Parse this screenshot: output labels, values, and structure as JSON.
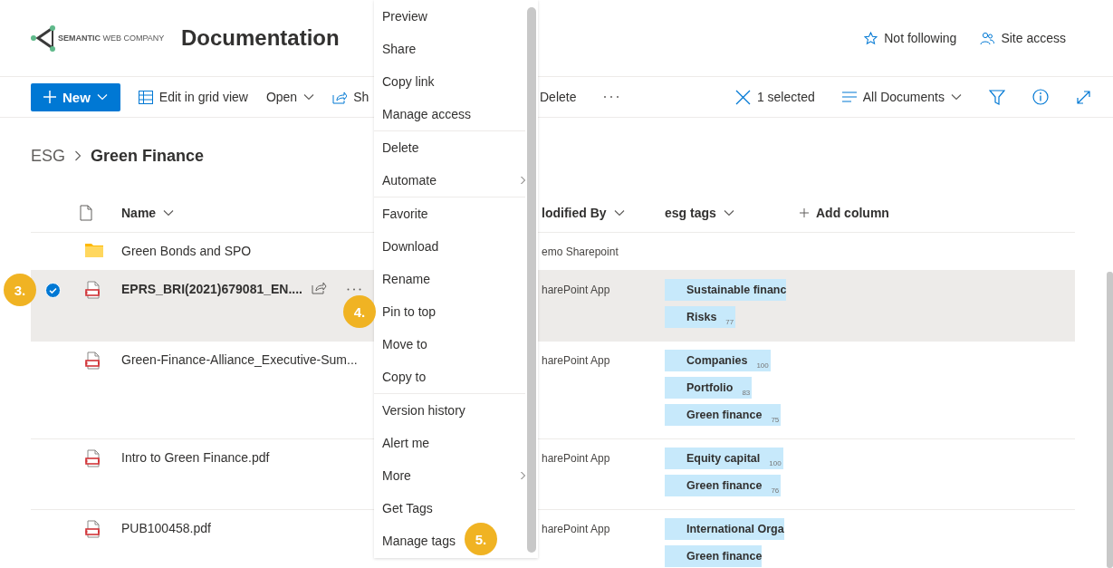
{
  "header": {
    "logo_text": "**SEMANTIC** WEB COMPANY",
    "title": "Documentation",
    "actions": [
      {
        "label": "Not following"
      },
      {
        "label": "Site access"
      }
    ]
  },
  "toolbar": {
    "left": [
      {
        "kind": "primary",
        "label": "New",
        "dropdown": true
      },
      {
        "kind": "grid",
        "label": "Edit in grid view"
      },
      {
        "kind": "plain",
        "label": "Open",
        "dropdown": true
      },
      {
        "kind": "share",
        "label": "Sh"
      }
    ],
    "after": [
      {
        "kind": "plain",
        "label": "Delete"
      },
      {
        "kind": "more"
      }
    ],
    "selection": "1 selected",
    "view": "All Documents"
  },
  "breadcrumb": [
    {
      "label": "ESG",
      "current": false
    },
    {
      "label": "Green Finance",
      "current": true
    }
  ],
  "table": {
    "columns": [
      {
        "label": "Name"
      },
      {
        "label": "lodified By"
      },
      {
        "label": "esg tags"
      }
    ],
    "add_column": "Add column",
    "rows": [
      {
        "kind": "folder",
        "name": "Green Bonds and SPO",
        "selected": false,
        "modified_by": "emo Sharepoint"
      },
      {
        "kind": "pdf",
        "name": "EPRS_BRI(2021)679081_EN....",
        "selected": true,
        "modified_by": "harePoint App",
        "tags": [
          {
            "label": "Sustainable financ"
          },
          {
            "label": "Risks",
            "score": "77"
          }
        ]
      },
      {
        "kind": "pdf",
        "name": "Green-Finance-Alliance_Executive-Sum...",
        "selected": false,
        "modified_by": "harePoint App",
        "tags": [
          {
            "label": "Companies",
            "score": "100"
          },
          {
            "label": "Portfolio",
            "score": "83"
          },
          {
            "label": "Green finance",
            "score": "75"
          }
        ]
      },
      {
        "kind": "pdf",
        "name": "Intro to Green Finance.pdf",
        "selected": false,
        "modified_by": "harePoint App",
        "tags": [
          {
            "label": "Equity capital",
            "score": "100"
          },
          {
            "label": "Green finance",
            "score": "76"
          }
        ]
      },
      {
        "kind": "pdf",
        "name": "PUB100458.pdf",
        "selected": false,
        "modified_by": "harePoint App",
        "tags": [
          {
            "label": "International Orga"
          },
          {
            "label": "Green finance"
          }
        ]
      }
    ]
  },
  "menu": {
    "groups": [
      [
        {
          "label": "Preview",
          "submenu": false
        },
        {
          "label": "Share",
          "submenu": false
        },
        {
          "label": "Copy link",
          "submenu": false
        },
        {
          "label": "Manage access",
          "submenu": false
        }
      ],
      [
        {
          "label": "Delete",
          "submenu": false
        },
        {
          "label": "Automate",
          "submenu": true
        }
      ],
      [
        {
          "label": "Favorite",
          "submenu": false
        },
        {
          "label": "Download",
          "submenu": false
        },
        {
          "label": "Rename",
          "submenu": false
        },
        {
          "label": "Pin to top",
          "submenu": false
        },
        {
          "label": "Move to",
          "submenu": false
        },
        {
          "label": "Copy to",
          "submenu": false
        }
      ],
      [
        {
          "label": "Version history",
          "submenu": false
        },
        {
          "label": "Alert me",
          "submenu": false
        },
        {
          "label": "More",
          "submenu": true
        },
        {
          "label": "Get Tags",
          "submenu": false
        },
        {
          "label": "Manage tags",
          "submenu": false
        }
      ]
    ]
  },
  "callouts": [
    {
      "label": "3."
    },
    {
      "label": "4."
    },
    {
      "label": "5."
    }
  ]
}
